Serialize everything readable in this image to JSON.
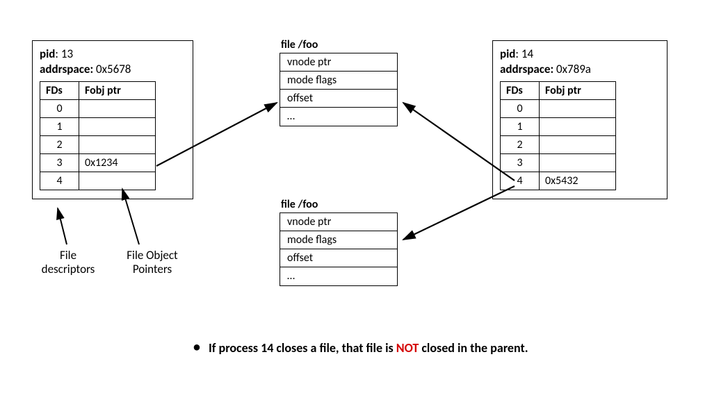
{
  "proc1": {
    "pid_label": "pid",
    "pid_value": "13",
    "addr_label": "addrspace:",
    "addr_value": "0x5678",
    "col_fd": "FDs",
    "col_ptr": "Fobj ptr",
    "rows": [
      {
        "fd": "0",
        "ptr": ""
      },
      {
        "fd": "1",
        "ptr": ""
      },
      {
        "fd": "2",
        "ptr": ""
      },
      {
        "fd": "3",
        "ptr": "0x1234"
      },
      {
        "fd": "4",
        "ptr": ""
      }
    ]
  },
  "proc2": {
    "pid_label": "pid",
    "pid_value": "14",
    "addr_label": "addrspace:",
    "addr_value": "0x789a",
    "col_fd": "FDs",
    "col_ptr": "Fobj ptr",
    "rows": [
      {
        "fd": "0",
        "ptr": ""
      },
      {
        "fd": "1",
        "ptr": ""
      },
      {
        "fd": "2",
        "ptr": ""
      },
      {
        "fd": "3",
        "ptr": ""
      },
      {
        "fd": "4",
        "ptr": "0x5432"
      }
    ]
  },
  "file1": {
    "title": "file /foo",
    "cells": [
      "vnode ptr",
      "mode flags",
      "offset",
      "…"
    ]
  },
  "file2": {
    "title": "file /foo",
    "cells": [
      "vnode ptr",
      "mode flags",
      "offset",
      "…"
    ]
  },
  "labels": {
    "fds": "File\ndescriptors",
    "fobj": "File Object\nPointers"
  },
  "note": {
    "pre": "If process 14 closes a file, that file is ",
    "red": "NOT",
    "post": " closed in the parent."
  }
}
